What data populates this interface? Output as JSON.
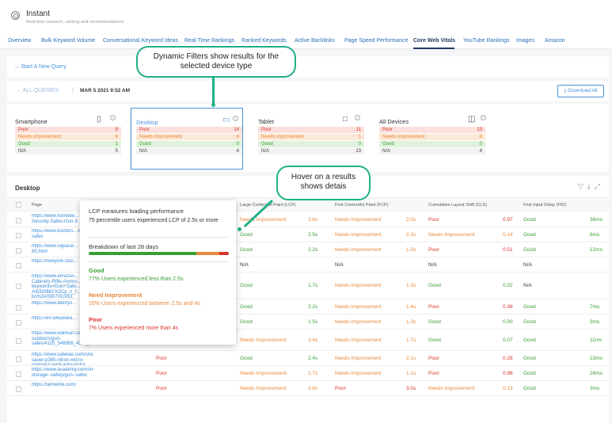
{
  "app": {
    "title": "Instant",
    "subtitle": "Real-time research, ranking and recommendations"
  },
  "tabs": [
    {
      "label": "Overview"
    },
    {
      "label": "Bulk Keyword Volume"
    },
    {
      "label": "Conversational Keyword Ideas"
    },
    {
      "label": "Real-Time Rankings"
    },
    {
      "label": "Ranked Keywords"
    },
    {
      "label": "Active Backlinks"
    },
    {
      "label": "Page Speed Performance"
    },
    {
      "label": "Core Web Vitals",
      "active": true
    },
    {
      "label": "YouTube Rankings"
    },
    {
      "label": "Images"
    },
    {
      "label": "Amazon"
    }
  ],
  "query": {
    "start_label": "Start A New Query"
  },
  "breadcrumb": {
    "back": "ALL QUERIES",
    "separator": "/",
    "date": "MAR 5 2021 9:52 AM",
    "download": "Download All"
  },
  "devices": [
    {
      "name": "Smartphone",
      "icon": "smartphone-icon",
      "poor": "9",
      "ni": "8",
      "good": "1",
      "na": "5"
    },
    {
      "name": "Desktop",
      "icon": "monitor-icon",
      "selected": true,
      "poor": "14",
      "ni": "6",
      "good": "0",
      "na": "4"
    },
    {
      "name": "Tablet",
      "icon": "tablet-icon",
      "poor": "11",
      "ni": "1",
      "good": "0",
      "na": "13"
    },
    {
      "name": "All Devices",
      "icon": "devices-icon",
      "poor": "13",
      "ni": "6",
      "good": "0",
      "na": "4"
    }
  ],
  "labels": {
    "poor": "Poor",
    "ni": "Needs improvement",
    "good": "Good",
    "na": "N/A"
  },
  "table": {
    "title": "Desktop",
    "headers": {
      "page": "Page",
      "lcp": "Large Contentful Paint (LCP)",
      "fcp": "First Contentful Paint (FCP)",
      "cls": "Cumulative Layout Shift (CLS)",
      "fid": "First Input Delay (FID)"
    },
    "rows": [
      {
        "url": "https://www.homede…Security-Safes-Gun-S",
        "overall": "",
        "lcp": "Needs Improvement",
        "lcp_v": "3.6s",
        "fcp": "Needs Improvement",
        "fcp_v": "2.0s",
        "cls": "Poor",
        "cls_v": "0.97",
        "fid": "Good",
        "fid_v": "36ms"
      },
      {
        "url": "https://www.tractors…n-safes",
        "overall": "",
        "lcp": "Good",
        "lcp_v": "2.5s",
        "fcp": "Needs Improvement",
        "fcp_v": "2.2s",
        "cls": "Needs Improvement",
        "cls_v": "0.14",
        "fid": "Good",
        "fid_v": "6ms"
      },
      {
        "url": "https://www.sigsaue…65.html",
        "overall": "",
        "lcp": "Good",
        "lcp_v": "2.2s",
        "fcp": "Needs Improvement",
        "fcp_v": "1.0s",
        "cls": "Poor",
        "cls_v": "0.51",
        "fid": "Good",
        "fid_v": "12ms"
      },
      {
        "url": "https://newyork.cbsl…",
        "overall": "",
        "lcp": "N/A",
        "lcp_v": "",
        "fcp": "N/A",
        "fcp_v": "",
        "cls": "N/A",
        "cls_v": "",
        "fid": "N/A",
        "fid_v": ""
      },
      {
        "url": "https://www.amazon…Cabinets-Rifle-Ammo…keywords=Gun+Safe…A42D0861%2Cp_n_f…bn%3A5907010011",
        "overall": "",
        "lcp": "Good",
        "lcp_v": "1.7s",
        "fcp": "Needs Improvement",
        "fcp_v": "1.3s",
        "cls": "Good",
        "cls_v": "0.02",
        "fid": "N/A",
        "fid_v": ""
      },
      {
        "url": "https://www.libertys…",
        "overall": "",
        "lcp": "Good",
        "lcp_v": "2.2s",
        "fcp": "Needs Improvement",
        "fcp_v": "1.4s",
        "cls": "Poor",
        "cls_v": "0.38",
        "fid": "Good",
        "fid_v": "7ms"
      },
      {
        "url": "https://en.wikipedia.…",
        "overall": "",
        "lcp": "Good",
        "lcp_v": "1.5s",
        "fcp": "Needs Improvement",
        "fcp_v": "1.3s",
        "cls": "Good",
        "cls_v": "0.00",
        "fid": "Good",
        "fid_v": "3ms"
      },
      {
        "url": "https://www.walmart.com/browse/sports-outdoors/gun-safes/4125_546956_4155_1092124_1080224",
        "overall": "Needs Improvement",
        "lcp": "Needs Improvement",
        "lcp_v": "3.4s",
        "fcp": "Needs Improvement",
        "fcp_v": "1.7s",
        "cls": "Good",
        "cls_v": "0.07",
        "fid": "Good",
        "fid_v": "11ms"
      },
      {
        "url": "https://www.cabelas.com/shop/en/sig-sauer-p365-nitron-micro-compact-semi-auto-pistol",
        "overall": "Poor",
        "lcp": "Good",
        "lcp_v": "2.4s",
        "fcp": "Needs Improvement",
        "fcp_v": "2.1s",
        "cls": "Poor",
        "cls_v": "0.28",
        "fid": "Good",
        "fid_v": "23ms"
      },
      {
        "url": "https://www.academy.com/shop/browse/outdoors/shooting/gun-storage--safety/gun--safes",
        "overall": "Poor",
        "lcp": "Needs Improvement",
        "lcp_v": "2.7s",
        "fcp": "Needs Improvement",
        "fcp_v": "1.1s",
        "cls": "Poor",
        "cls_v": "0.98",
        "fid": "Good",
        "fid_v": "28ms"
      },
      {
        "url": "https://tannerite.com/",
        "overall": "Poor",
        "lcp": "Needs Improvement",
        "lcp_v": "3.8s",
        "fcp": "Poor",
        "fcp_v": "3.0s",
        "cls": "Needs Improvement",
        "cls_v": "0.13",
        "fid": "Good",
        "fid_v": "3ms"
      }
    ]
  },
  "tooltip": {
    "title": "LCP measures loading performance",
    "desc": "75 percentile users experienced LCP of 2.5s or more",
    "breakdown": "Breakdown of last 28 days",
    "bar": {
      "good": 77,
      "ni": 16,
      "poor": 7
    },
    "good_h": "Good",
    "good_t": "77% Users experienced less than 2.5s",
    "ni_h": "Need Improvement",
    "ni_t": "16% Users experienced between 2.5s and 4s",
    "poor_h": "Poor",
    "poor_t": "7% Users experienced more than 4s"
  },
  "callouts": {
    "filters": "Dynamic Filters show results for the selected device type",
    "hover": "Hover on a results shows detais"
  },
  "colors": {
    "good": "#3a9d34",
    "ni": "#e8893a",
    "poor": "#d9342b",
    "accent": "#1fb088",
    "link": "#4a90d9"
  }
}
